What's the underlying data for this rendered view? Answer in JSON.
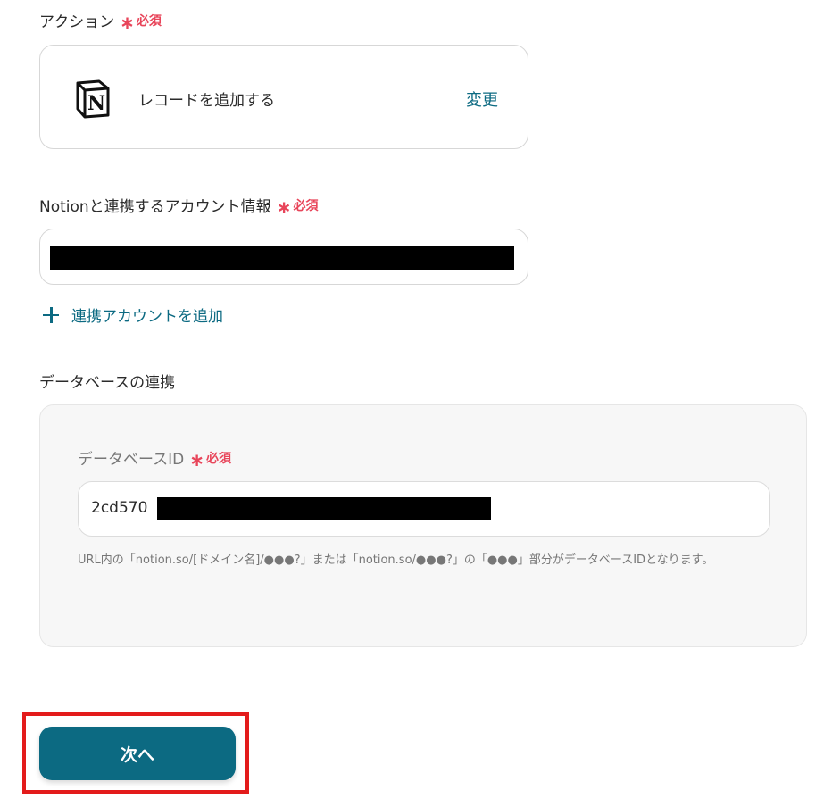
{
  "action": {
    "label": "アクション",
    "required_star": "∗",
    "required_text": "必須",
    "app_icon": "notion-icon",
    "name": "レコードを追加する",
    "change_label": "変更"
  },
  "account": {
    "label": "Notionと連携するアカウント情報",
    "required_star": "∗",
    "required_text": "必須",
    "add_label": "連携アカウントを追加"
  },
  "database": {
    "section_label": "データベースの連携",
    "field_label": "データベースID",
    "required_star": "∗",
    "required_text": "必須",
    "value": "2cd570",
    "help_text": "URL内の「notion.so/[ドメイン名]/●●●?」または「notion.so/●●●?」の「●●●」部分がデータベースIDとなります。"
  },
  "footer": {
    "next_label": "次へ"
  },
  "colors": {
    "accent": "#0c6a82",
    "required": "#e8455a",
    "highlight": "#e31b1b"
  }
}
